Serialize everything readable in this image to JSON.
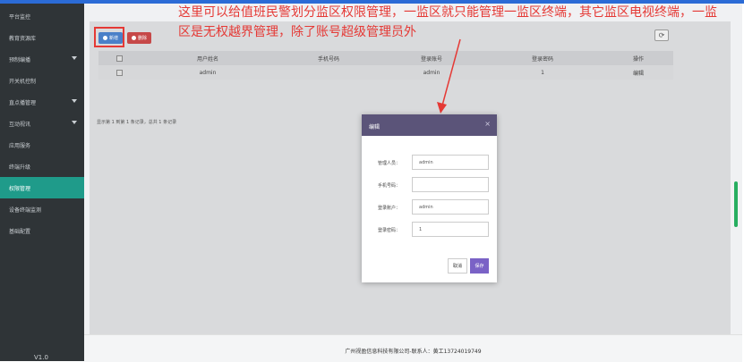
{
  "sidebar": {
    "items": [
      {
        "label": "平台监控"
      },
      {
        "label": "教育资源库"
      },
      {
        "label": "预制编播"
      },
      {
        "label": "开关机控制"
      },
      {
        "label": "直点播管理"
      },
      {
        "label": "互动视讯"
      },
      {
        "label": "应用服务"
      },
      {
        "label": "终端升级"
      },
      {
        "label": "权限管理"
      },
      {
        "label": "设备终端监测"
      },
      {
        "label": "基础配置"
      }
    ],
    "active": "权限管理",
    "version": "V1.0"
  },
  "toolbar": {
    "add_label": "新增",
    "delete_label": "删除"
  },
  "table": {
    "columns": [
      "",
      "用户姓名",
      "手机号码",
      "登录账号",
      "登录密码",
      "操作"
    ],
    "rows": [
      {
        "name": "admin",
        "phone": "",
        "account": "admin",
        "password": "1",
        "action": "编辑"
      }
    ],
    "summary": "显示第 1 到第 1 条记录，总共 1 条记录"
  },
  "annotation": "这里可以给值班民警划分监区权限管理，一监区就只能管理一监区终端，其它监区电视终端，一监区是无权越界管理，除了账号超级管理员外",
  "modal": {
    "title": "编辑",
    "close": "×",
    "fields": [
      {
        "label": "管理人员：",
        "value": "admin"
      },
      {
        "label": "手机号码：",
        "value": ""
      },
      {
        "label": "登录账户：",
        "value": "admin"
      },
      {
        "label": "登录密码：",
        "value": "1"
      }
    ],
    "cancel": "取消",
    "save": "保存"
  },
  "footer": {
    "text": "广州视盈信息科技有限公司-联系人：黄工13724019749"
  },
  "icons": {
    "refresh": "refresh-icon",
    "add": "plus-circle-icon",
    "delete": "minus-circle-icon",
    "close": "close-icon"
  },
  "colors": {
    "sidebar": "#2f3437",
    "active": "#1f9b8a",
    "annotation": "#e53935",
    "save": "#7a62c6",
    "modal_header": "#5b5479"
  }
}
